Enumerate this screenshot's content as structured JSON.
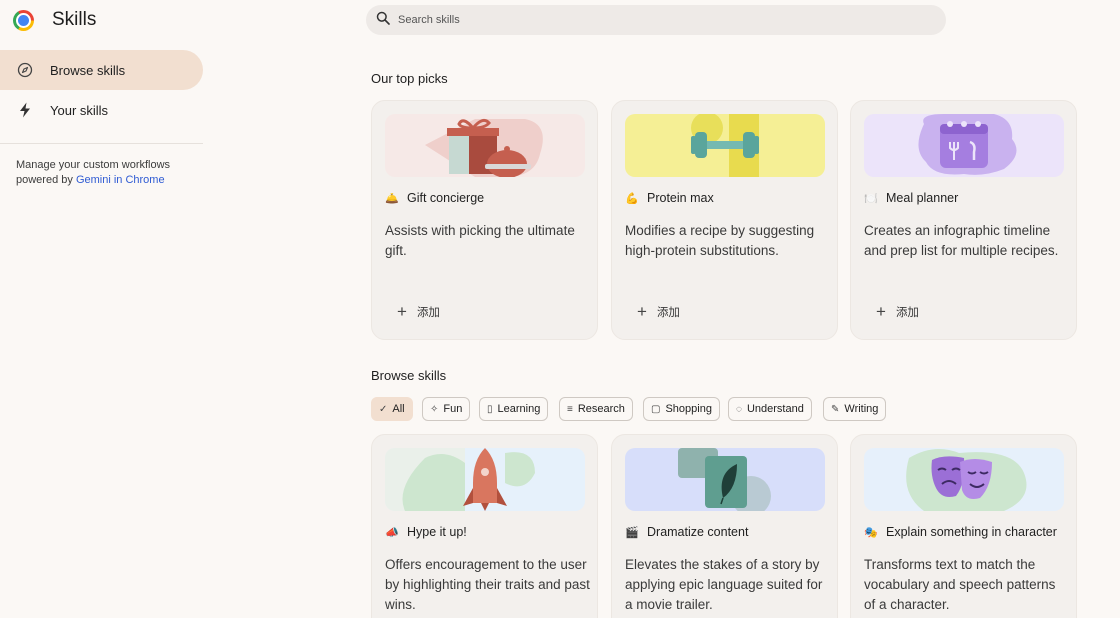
{
  "app": {
    "title": "Skills"
  },
  "sidebar": {
    "items": [
      {
        "label": "Browse skills",
        "icon": "compass-icon",
        "active": true
      },
      {
        "label": "Your skills",
        "icon": "bolt-icon",
        "active": false
      }
    ],
    "note_text": "Manage your custom workflows powered by ",
    "note_link": "Gemini in Chrome"
  },
  "search": {
    "placeholder": "Search skills"
  },
  "top_picks": {
    "title": "Our top picks",
    "add_label": "添加",
    "cards": [
      {
        "emoji": "🛎️",
        "name": "Gift concierge",
        "desc": "Assists with picking the ultimate gift."
      },
      {
        "emoji": "💪",
        "name": "Protein max",
        "desc": "Modifies a recipe by suggesting high-protein substitutions."
      },
      {
        "emoji": "🍽️",
        "name": "Meal planner",
        "desc": "Creates an infographic timeline and prep list for multiple recipes."
      }
    ]
  },
  "browse": {
    "title": "Browse skills",
    "chips": [
      {
        "label": "All",
        "icon": "check-icon",
        "selected": true
      },
      {
        "label": "Fun",
        "icon": "party-icon",
        "selected": false
      },
      {
        "label": "Learning",
        "icon": "book-icon",
        "selected": false
      },
      {
        "label": "Research",
        "icon": "research-icon",
        "selected": false
      },
      {
        "label": "Shopping",
        "icon": "shopping-bag-icon",
        "selected": false
      },
      {
        "label": "Understand",
        "icon": "lightbulb-icon",
        "selected": false
      },
      {
        "label": "Writing",
        "icon": "pen-icon",
        "selected": false
      }
    ],
    "cards": [
      {
        "emoji": "📣",
        "name": "Hype it up!",
        "desc": "Offers encouragement to the user by highlighting their traits and past wins."
      },
      {
        "emoji": "🎬",
        "name": "Dramatize content",
        "desc": "Elevates the stakes of a story by applying epic language suited for a movie trailer."
      },
      {
        "emoji": "🎭",
        "name": "Explain something in character",
        "desc": "Transforms text to match the vocabulary and speech patterns of a character."
      }
    ]
  },
  "colors": {
    "accent": "#f2dfd0",
    "link": "#2f5bd3",
    "card": "#f3f0ed"
  }
}
